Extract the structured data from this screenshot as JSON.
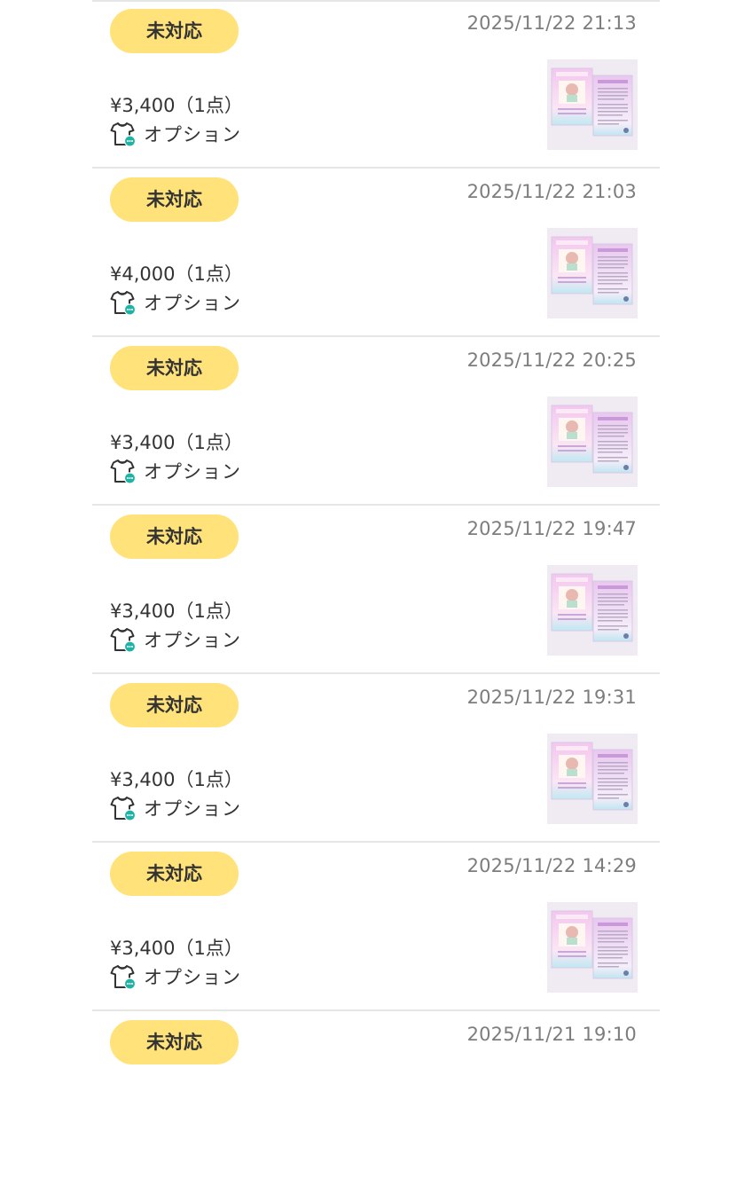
{
  "colors": {
    "status_badge_bg": "#ffe27a",
    "divider": "#e6e6e6",
    "date_text": "#7d7d7d",
    "option_icon_accent": "#1fb3a5"
  },
  "icons": {
    "option": "t-shirt-with-dots-icon",
    "product": "product-thumbnail-image"
  },
  "orders": [
    {
      "status": "未対応",
      "date": "2025/11/22 21:13",
      "price": "¥3,400（1点）",
      "option_label": "オプション"
    },
    {
      "status": "未対応",
      "date": "2025/11/22 21:03",
      "price": "¥4,000（1点）",
      "option_label": "オプション"
    },
    {
      "status": "未対応",
      "date": "2025/11/22 20:25",
      "price": "¥3,400（1点）",
      "option_label": "オプション"
    },
    {
      "status": "未対応",
      "date": "2025/11/22 19:47",
      "price": "¥3,400（1点）",
      "option_label": "オプション"
    },
    {
      "status": "未対応",
      "date": "2025/11/22 19:31",
      "price": "¥3,400（1点）",
      "option_label": "オプション"
    },
    {
      "status": "未対応",
      "date": "2025/11/22 14:29",
      "price": "¥3,400（1点）",
      "option_label": "オプション"
    },
    {
      "status": "未対応",
      "date": "2025/11/21 19:10"
    }
  ]
}
